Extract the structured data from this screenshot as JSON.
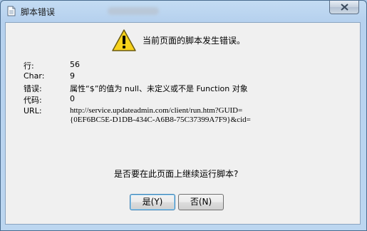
{
  "window": {
    "title": "脚本错误"
  },
  "message": {
    "headline": "当前页面的脚本发生错误。"
  },
  "details": {
    "line_label": "行:",
    "line_value": "56",
    "char_label": "Char:",
    "char_value": "9",
    "error_label": "错误:",
    "error_value": "属性“$”的值为 null、未定义或不是 Function 对象",
    "code_label": "代码:",
    "code_value": "0",
    "url_label": "URL:",
    "url_line1": "http://service.updateadmin.com/client/run.htm?GUID=",
    "url_line2": "{0EF6BC5E-D1DB-434C-A6B8-75C37399A7F9}&cid="
  },
  "prompt": {
    "question": "是否要在此页面上继续运行脚本?"
  },
  "buttons": {
    "yes_label": "是(Y)",
    "no_label": "否(N)"
  },
  "colors": {
    "warning_fill": "#f7d21b",
    "titlebar": "#b6d1ee"
  }
}
